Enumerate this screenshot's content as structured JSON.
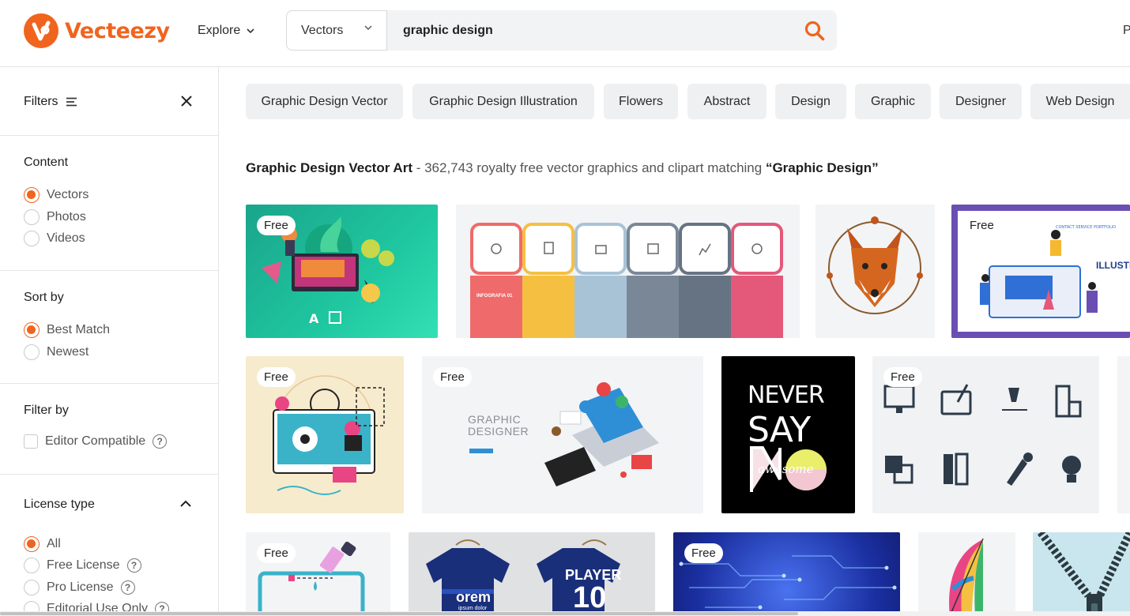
{
  "header": {
    "logo_text": "Vecteezy",
    "explore_label": "Explore",
    "search_type": "Vectors",
    "search_value": "graphic design",
    "edge_text": "P"
  },
  "sidebar": {
    "filters_label": "Filters",
    "content": {
      "title": "Content",
      "options": [
        "Vectors",
        "Photos",
        "Videos"
      ],
      "selected": "Vectors"
    },
    "sort": {
      "title": "Sort by",
      "options": [
        "Best Match",
        "Newest"
      ],
      "selected": "Best Match"
    },
    "filter_by": {
      "title": "Filter by",
      "options": [
        "Editor Compatible"
      ]
    },
    "license": {
      "title": "License type",
      "options": [
        "All",
        "Free License",
        "Pro License",
        "Editorial Use Only"
      ],
      "selected": "All"
    }
  },
  "tags": [
    "Graphic Design Vector",
    "Graphic Design Illustration",
    "Flowers",
    "Abstract",
    "Design",
    "Graphic",
    "Designer",
    "Web Design"
  ],
  "results": {
    "heading": "Graphic Design Vector Art",
    "summary": " - 362,743 royalty free vector graphics and clipart matching ",
    "query_quoted": "“Graphic Design”"
  },
  "free_badge": "Free",
  "tile_texts": {
    "infographic_label": "INFOGRAFIA 01",
    "designer_title_1": "GRAPHIC",
    "designer_title_2": "DESIGNER",
    "illustr": "ILLUSTR",
    "never": "NEVER",
    "say": "SAY",
    "no": "NO",
    "awesome": "awesome",
    "shirt_text": "orem",
    "player": "PLAYER",
    "number": "10",
    "ipsum": "ipsum dolor"
  },
  "colors": {
    "brand": "#f0641e",
    "search_icon": "#f0641e"
  }
}
